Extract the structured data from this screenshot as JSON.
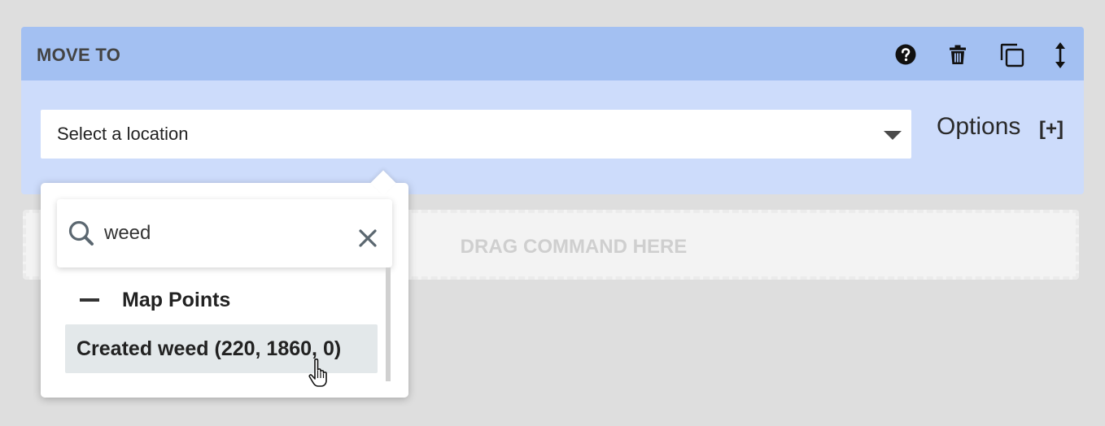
{
  "step": {
    "title": "MOVE TO",
    "icons": {
      "help": "help-circle-icon",
      "delete": "trash-icon",
      "duplicate": "copy-icon",
      "reorder": "vertical-arrows-icon"
    }
  },
  "location_select": {
    "placeholder": "Select a location",
    "icon": "caret-down-icon"
  },
  "options": {
    "label": "Options",
    "toggle": "[+]"
  },
  "drop_zone": {
    "label": "DRAG COMMAND HERE"
  },
  "dropdown": {
    "search": {
      "value": "weed",
      "icon": "search-icon",
      "clear_icon": "close-icon"
    },
    "groups": [
      {
        "label": "Map Points",
        "items": [
          {
            "label": "Created weed (220, 1860, 0)"
          }
        ]
      }
    ]
  },
  "colors": {
    "header": "#a3c0f2",
    "body": "#cddcfb",
    "background": "#dedede",
    "highlight": "#e3e8ea"
  }
}
